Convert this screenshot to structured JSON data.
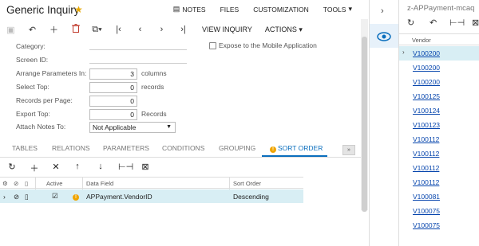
{
  "header": {
    "title": "Generic Inquiry",
    "links": [
      {
        "label": "NOTES",
        "icon": "notes-icon"
      },
      {
        "label": "FILES",
        "icon": ""
      },
      {
        "label": "CUSTOMIZATION",
        "icon": ""
      },
      {
        "label": "TOOLS",
        "icon": "chevron-down-icon"
      }
    ]
  },
  "toolbar": {
    "view_inquiry": "VIEW INQUIRY",
    "actions": "ACTIONS"
  },
  "form": {
    "category_label": "Category:",
    "screen_id_label": "Screen ID:",
    "arrange_label": "Arrange Parameters In:",
    "arrange_value": "3",
    "arrange_unit": "columns",
    "select_top_label": "Select Top:",
    "select_top_value": "0",
    "select_top_unit": "records",
    "records_per_page_label": "Records per Page:",
    "records_per_page_value": "0",
    "export_top_label": "Export Top:",
    "export_top_value": "0",
    "export_top_unit": "Records",
    "attach_notes_label": "Attach Notes To:",
    "attach_notes_value": "Not Applicable",
    "mobile_label": "Expose to the Mobile Application"
  },
  "tabs": [
    {
      "label": "TABLES"
    },
    {
      "label": "RELATIONS"
    },
    {
      "label": "PARAMETERS"
    },
    {
      "label": "CONDITIONS"
    },
    {
      "label": "GROUPING"
    },
    {
      "label": "SORT ORDER",
      "active": true
    }
  ],
  "grid": {
    "headers": {
      "active": "Active",
      "data_field": "Data Field",
      "sort_order": "Sort Order"
    },
    "rows": [
      {
        "active": true,
        "data_field": "APPayment.VendorID",
        "sort_order": "Descending"
      }
    ]
  },
  "right_panel": {
    "title": "z-APPayment-mcaq",
    "column": "Vendor",
    "vendors": [
      "V100200",
      "V100200",
      "V100200",
      "V100125",
      "V100124",
      "V100123",
      "V100112",
      "V100112",
      "V100112",
      "V100112",
      "V100081",
      "V100075",
      "V100075"
    ]
  },
  "colors": {
    "accent": "#0a6ebd",
    "selected_row": "#d8eef4",
    "warning": "#f0a500",
    "star": "#e6a700",
    "link": "#0645ad"
  }
}
